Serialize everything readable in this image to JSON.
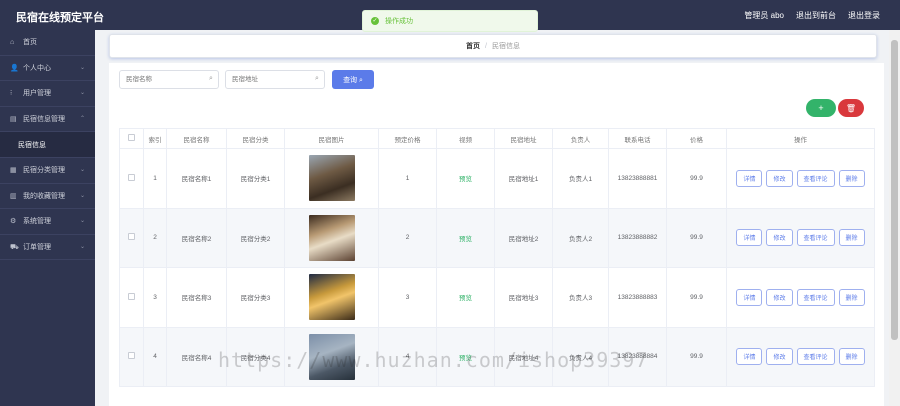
{
  "app": {
    "title": "民宿在线预定平台"
  },
  "header": {
    "user": "管理员 abo",
    "back": "退出到前台",
    "logout": "退出登录"
  },
  "toast": {
    "text": "操作成功"
  },
  "sidebar": {
    "items": [
      {
        "icon": "⌂",
        "label": "首页",
        "chev": ""
      },
      {
        "icon": "👤",
        "label": "个人中心",
        "chev": "⌄"
      },
      {
        "icon": "⁝",
        "label": "用户管理",
        "chev": "⌄"
      },
      {
        "icon": "▤",
        "label": "民宿信息管理",
        "chev": "⌃"
      },
      {
        "icon": "",
        "label": "民宿信息",
        "chev": ""
      },
      {
        "icon": "▦",
        "label": "民宿分类管理",
        "chev": "⌄"
      },
      {
        "icon": "▥",
        "label": "我的收藏管理",
        "chev": "⌄"
      },
      {
        "icon": "⚙",
        "label": "系统管理",
        "chev": "⌄"
      },
      {
        "icon": "⛟",
        "label": "订单管理",
        "chev": "⌄"
      }
    ]
  },
  "breadcrumb": {
    "home": "首页",
    "sep": "/",
    "current": "民宿信息"
  },
  "search": {
    "name_placeholder": "民宿名称",
    "address_placeholder": "民宿地址",
    "query_label": "查询 ⌕"
  },
  "toolbar": {
    "add_label": "+",
    "delete_label": "🗑"
  },
  "table": {
    "headers": [
      "索引",
      "民宿名称",
      "民宿分类",
      "民宿图片",
      "预定价格",
      "视频",
      "民宿地址",
      "负责人",
      "联系电话",
      "价格",
      "操作"
    ],
    "actions": [
      "详情",
      "修改",
      "查看评论",
      "删除"
    ],
    "rows": [
      {
        "index": "1",
        "name": "民宿名称1",
        "category": "民宿分类1",
        "booking": "1",
        "video": "预览",
        "address": "民宿地址1",
        "owner": "负责人1",
        "phone": "13823888881",
        "price": "99.9"
      },
      {
        "index": "2",
        "name": "民宿名称2",
        "category": "民宿分类2",
        "booking": "2",
        "video": "预览",
        "address": "民宿地址2",
        "owner": "负责人2",
        "phone": "13823888882",
        "price": "99.9"
      },
      {
        "index": "3",
        "name": "民宿名称3",
        "category": "民宿分类3",
        "booking": "3",
        "video": "预览",
        "address": "民宿地址3",
        "owner": "负责人3",
        "phone": "13823888883",
        "price": "99.9"
      },
      {
        "index": "4",
        "name": "民宿名称4",
        "category": "民宿分类4",
        "booking": "4",
        "video": "预览",
        "address": "民宿地址4",
        "owner": "负责人4",
        "phone": "13823888884",
        "price": "99.9"
      }
    ]
  },
  "watermark": "https://www.huzhan.com/ishop39397",
  "colors": {
    "sidebar": "#2f3550",
    "primary": "#5b7be9",
    "success": "#33b36a",
    "danger": "#d9383c"
  }
}
